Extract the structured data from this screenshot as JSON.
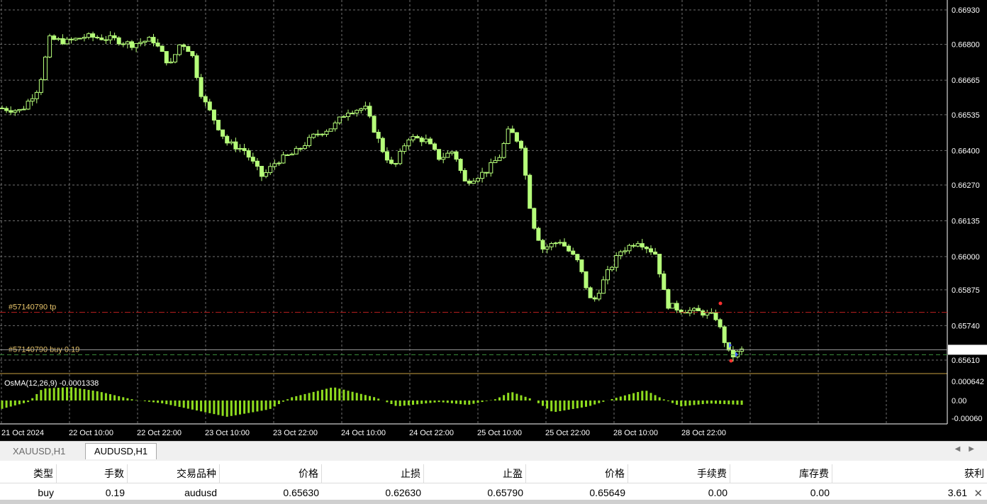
{
  "chart": {
    "symbol_tabs": [
      "XAUUSD,H1",
      "AUDUSD,H1"
    ],
    "active_tab": "AUDUSD,H1",
    "price_axis": [
      "0.66930",
      "0.66800",
      "0.66665",
      "0.66535",
      "0.66400",
      "0.66270",
      "0.66135",
      "0.66000",
      "0.65875",
      "0.65740",
      "0.65610"
    ],
    "current_price": "0.65649",
    "time_axis": [
      "21 Oct 2024",
      "22 Oct 10:00",
      "22 Oct 22:00",
      "23 Oct 10:00",
      "23 Oct 22:00",
      "24 Oct 10:00",
      "24 Oct 22:00",
      "25 Oct 10:00",
      "25 Oct 22:00",
      "28 Oct 10:00",
      "28 Oct 22:00"
    ],
    "tp_line_label": "#57140790 tp",
    "order_line_label": "#57140790 buy 0.19",
    "osma_label": "OsMA(12,26,9) -0.0001338",
    "osma_axis": [
      "0.000642",
      "0.00",
      "-0.00060"
    ],
    "colors": {
      "background": "#000000",
      "grid": "#6f6f6f",
      "candle_up": "#000000",
      "candle_border": "#b6ff7a",
      "candle_down": "#b6ff7a",
      "osma": "#8fdc1e",
      "tp_line": "#c02020",
      "order_line": "#3a8a3a",
      "price_tag_bg": "#ffffff"
    }
  },
  "trade_table": {
    "headers": [
      "类型",
      "手数",
      "交易品种",
      "价格",
      "止损",
      "止盈",
      "价格",
      "手续费",
      "库存费",
      "获利"
    ],
    "row": [
      "buy",
      "0.19",
      "audusd",
      "0.65630",
      "0.62630",
      "0.65790",
      "0.65649",
      "0.00",
      "0.00",
      "3.61"
    ]
  },
  "icons": [
    "close-icon",
    "scroll-left-icon",
    "scroll-right-icon"
  ]
}
